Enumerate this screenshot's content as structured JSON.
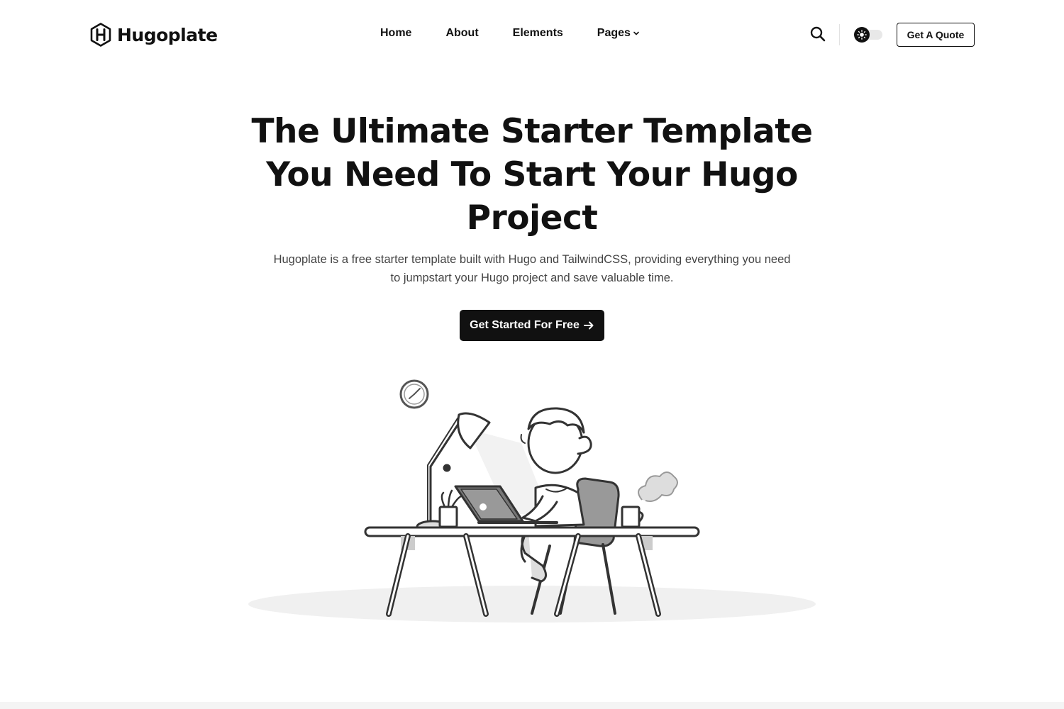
{
  "header": {
    "logo_text": "Hugoplate",
    "logo_icon": "hexagon-h-logo-icon",
    "nav": [
      {
        "label": "Home"
      },
      {
        "label": "About"
      },
      {
        "label": "Elements"
      },
      {
        "label": "Pages",
        "icon": "chevron-down-icon"
      }
    ],
    "search_icon": "search-icon",
    "theme_toggle_icon": "sun-icon",
    "quote_label": "Get A Quote"
  },
  "hero": {
    "title": "The Ultimate Starter Template You Need To Start Your Hugo Project",
    "description": "Hugoplate is a free starter template built with Hugo and TailwindCSS, providing everything you need to jumpstart your Hugo project and save valuable time.",
    "cta_label": "Get Started For Free",
    "cta_icon": "arrow-right-icon"
  },
  "colors": {
    "text": "#111111",
    "muted_text": "#444444",
    "button_bg": "#111111",
    "toggle_track": "#e8e8e8"
  }
}
